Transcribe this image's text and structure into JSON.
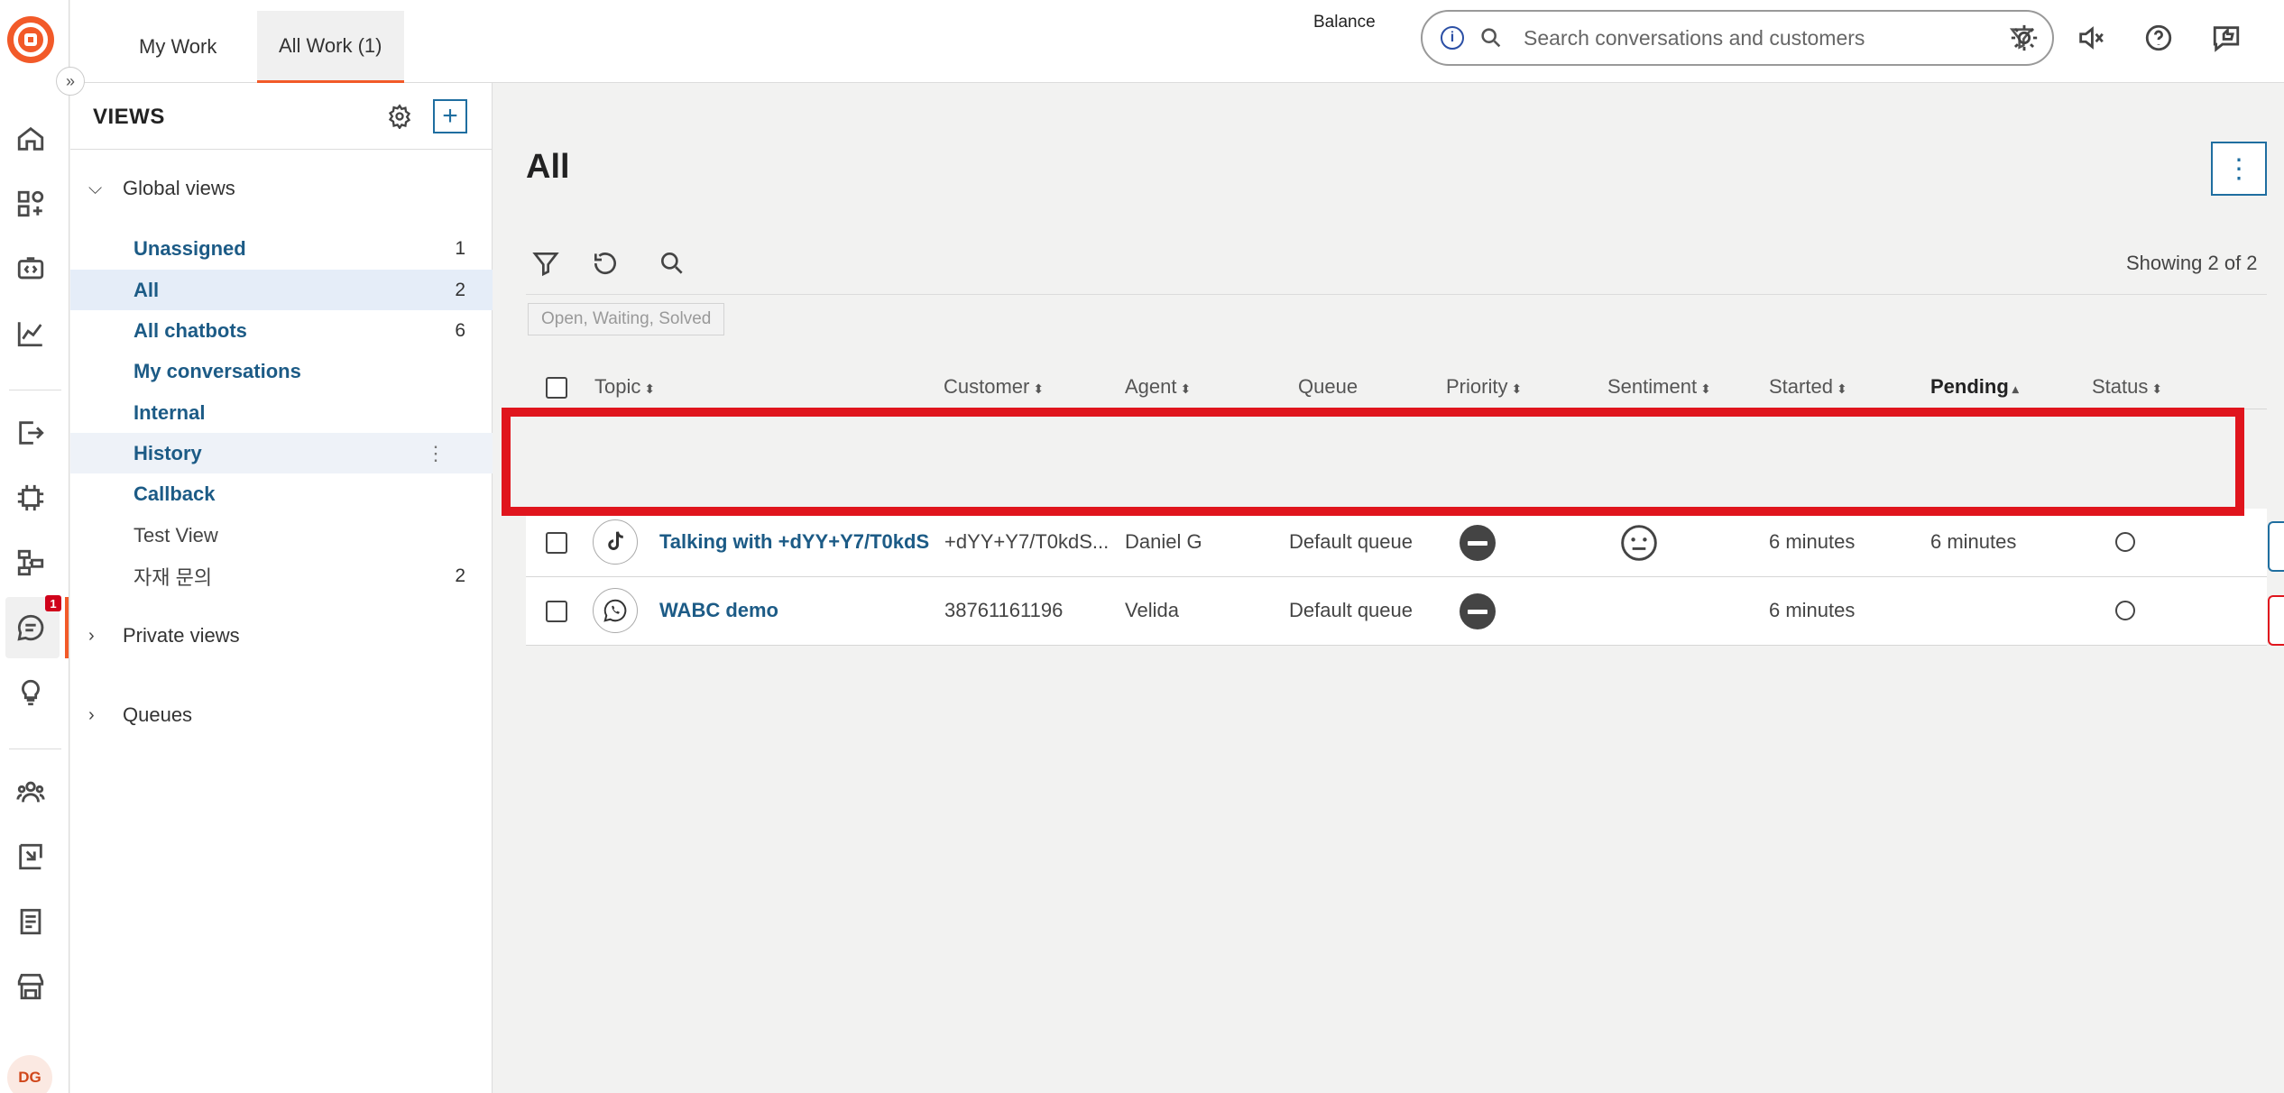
{
  "rail": {
    "logo": "brand-logo",
    "avatar_initials": "DG",
    "conversations_badge": "1",
    "icons": [
      "home-icon",
      "apps-icon",
      "code-icon",
      "analytics-icon",
      "export-icon",
      "ai-chip-icon",
      "flow-icon",
      "conversations-icon",
      "lightbulb-icon",
      "contacts-icon",
      "reports-icon",
      "notes-icon",
      "store-icon"
    ]
  },
  "topbar": {
    "tabs": [
      {
        "label": "My Work"
      },
      {
        "label": "All Work (1)",
        "active": true
      }
    ],
    "balance_label": "Balance",
    "search_placeholder": "Search conversations and customers"
  },
  "views": {
    "title": "VIEWS",
    "add_label": "+",
    "global_group": "Global views",
    "items": [
      {
        "label": "Unassigned",
        "count": "1"
      },
      {
        "label": "All",
        "count": "2"
      },
      {
        "label": "All chatbots",
        "count": "6"
      },
      {
        "label": "My conversations",
        "count": ""
      },
      {
        "label": "Internal",
        "count": ""
      },
      {
        "label": "History",
        "count": ""
      },
      {
        "label": "Callback",
        "count": ""
      },
      {
        "label": "Test View",
        "count": ""
      },
      {
        "label": "자재 문의",
        "count": "2"
      }
    ],
    "private_group": "Private views",
    "queues_group": "Queues"
  },
  "main": {
    "title": "All",
    "more_label": "⋮",
    "showing": "Showing 2 of 2",
    "filter_chip": "Open, Waiting, Solved",
    "columns": {
      "topic": "Topic",
      "customer": "Customer",
      "agent": "Agent",
      "queue": "Queue",
      "priority": "Priority",
      "sentiment": "Sentiment",
      "started": "Started",
      "pending": "Pending",
      "status": "Status"
    },
    "rows": [
      {
        "channel": "tiktok-icon",
        "topic": "Talking with +dYY+Y7/T0kdS",
        "customer": "+dYY+Y7/T0kdS...",
        "agent": "Daniel G",
        "queue": "Default queue",
        "sentiment": "neutral-face-icon",
        "started": "6 minutes",
        "pending": "6 minutes"
      },
      {
        "channel": "whatsapp-icon",
        "topic": "WABC demo",
        "customer": "38761161196",
        "agent": "Velida",
        "queue": "Default queue",
        "sentiment": "",
        "started": "6 minutes",
        "pending": ""
      }
    ]
  },
  "colors": {
    "brand": "#f25a29",
    "link": "#1c5b86",
    "selected_bg": "#e5edf8",
    "highlight": "#e0151d"
  }
}
